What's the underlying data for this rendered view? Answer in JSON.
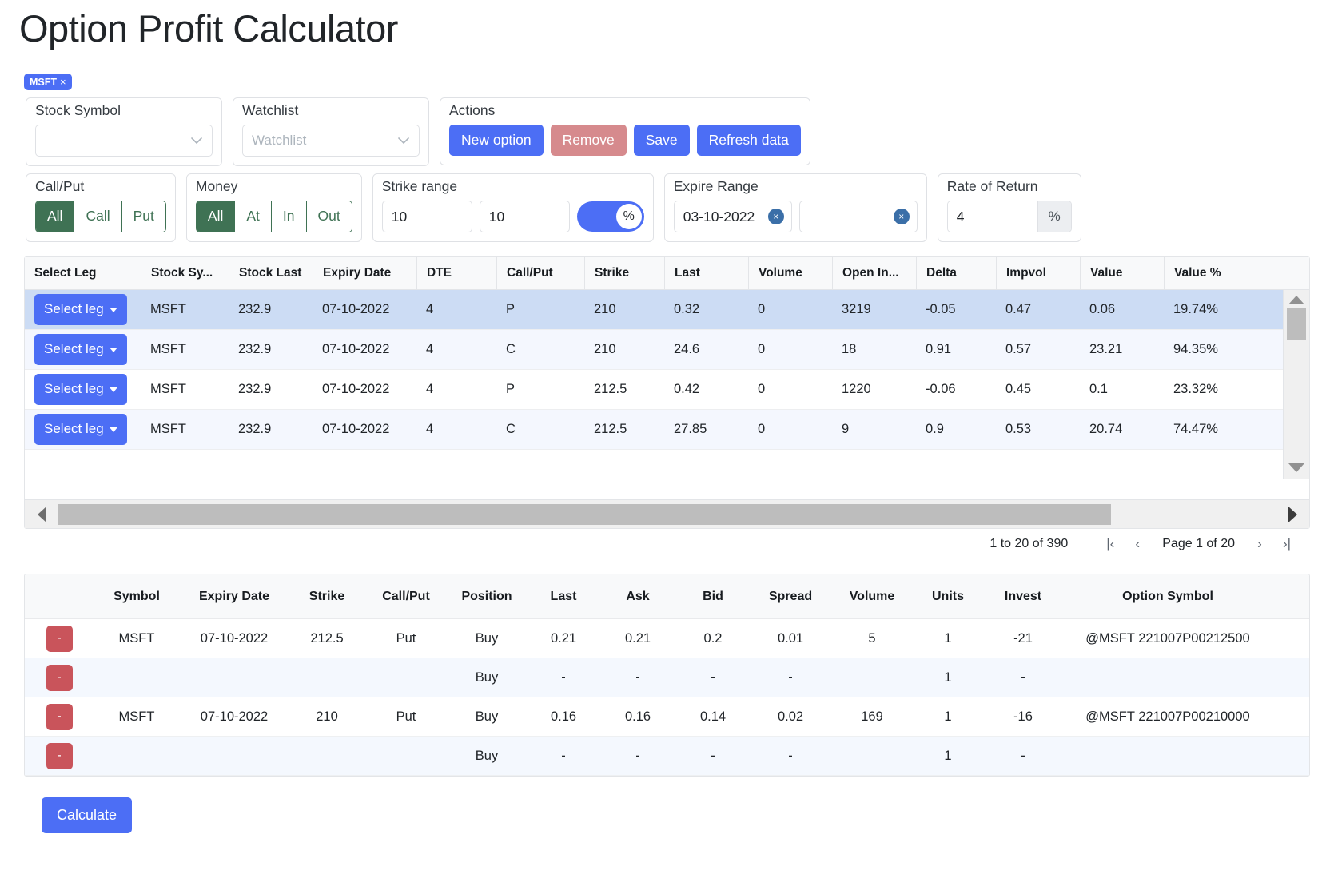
{
  "page_title": "Option Profit Calculator",
  "symbol_chip": {
    "label": "MSFT",
    "close": "×"
  },
  "filters": {
    "stock_symbol": {
      "legend": "Stock Symbol",
      "value": "",
      "placeholder": ""
    },
    "watchlist": {
      "legend": "Watchlist",
      "value": "",
      "placeholder": "Watchlist"
    },
    "actions": {
      "legend": "Actions",
      "new_option": "New option",
      "remove": "Remove",
      "save": "Save",
      "refresh": "Refresh data"
    },
    "call_put": {
      "legend": "Call/Put",
      "options": [
        "All",
        "Call",
        "Put"
      ],
      "selected": "All"
    },
    "money": {
      "legend": "Money",
      "options": [
        "All",
        "At",
        "In",
        "Out"
      ],
      "selected": "All"
    },
    "strike_range": {
      "legend": "Strike range",
      "low": "10",
      "high": "10",
      "percent_toggle": "%",
      "percent_on": true
    },
    "expire_range": {
      "legend": "Expire Range",
      "from": "03-10-2022",
      "to": "",
      "clear": "×"
    },
    "rate_of_return": {
      "legend": "Rate of Return",
      "value": "4",
      "suffix": "%"
    }
  },
  "options_grid": {
    "columns": [
      "Select Leg",
      "Stock Sy...",
      "Stock Last",
      "Expiry Date",
      "DTE",
      "Call/Put",
      "Strike",
      "Last",
      "Volume",
      "Open In...",
      "Delta",
      "Impvol",
      "Value",
      "Value %"
    ],
    "select_leg_label": "Select leg",
    "rows": [
      {
        "symbol": "MSFT",
        "stock_last": "232.9",
        "expiry": "07-10-2022",
        "dte": "4",
        "cp": "P",
        "strike": "210",
        "last": "0.32",
        "volume": "0",
        "open_int": "3219",
        "delta": "-0.05",
        "impvol": "0.47",
        "value": "0.06",
        "value_pct": "19.74%"
      },
      {
        "symbol": "MSFT",
        "stock_last": "232.9",
        "expiry": "07-10-2022",
        "dte": "4",
        "cp": "C",
        "strike": "210",
        "last": "24.6",
        "volume": "0",
        "open_int": "18",
        "delta": "0.91",
        "impvol": "0.57",
        "value": "23.21",
        "value_pct": "94.35%"
      },
      {
        "symbol": "MSFT",
        "stock_last": "232.9",
        "expiry": "07-10-2022",
        "dte": "4",
        "cp": "P",
        "strike": "212.5",
        "last": "0.42",
        "volume": "0",
        "open_int": "1220",
        "delta": "-0.06",
        "impvol": "0.45",
        "value": "0.1",
        "value_pct": "23.32%"
      },
      {
        "symbol": "MSFT",
        "stock_last": "232.9",
        "expiry": "07-10-2022",
        "dte": "4",
        "cp": "C",
        "strike": "212.5",
        "last": "27.85",
        "volume": "0",
        "open_int": "9",
        "delta": "0.9",
        "impvol": "0.53",
        "value": "20.74",
        "value_pct": "74.47%"
      }
    ],
    "pagination": {
      "range_text_prefix": "1",
      "range_text": "1 to 20 of 390",
      "first": "|‹",
      "prev": "‹",
      "page_label": "Page 1 of 20",
      "next": "›",
      "last": "›|"
    }
  },
  "legs_table": {
    "columns": [
      "",
      "Symbol",
      "Expiry Date",
      "Strike",
      "Call/Put",
      "Position",
      "Last",
      "Ask",
      "Bid",
      "Spread",
      "Volume",
      "Units",
      "Invest",
      "Option Symbol"
    ],
    "remove_label": "-",
    "rows": [
      {
        "symbol": "MSFT",
        "expiry": "07-10-2022",
        "strike": "212.5",
        "cp": "Put",
        "position": "Buy",
        "last": "0.21",
        "ask": "0.21",
        "bid": "0.2",
        "spread": "0.01",
        "volume": "5",
        "units": "1",
        "invest": "-21",
        "option_symbol": "@MSFT 221007P00212500"
      },
      {
        "symbol": "",
        "expiry": "",
        "strike": "",
        "cp": "",
        "position": "Buy",
        "last": "-",
        "ask": "-",
        "bid": "-",
        "spread": "-",
        "volume": "",
        "units": "1",
        "invest": "-",
        "option_symbol": ""
      },
      {
        "symbol": "MSFT",
        "expiry": "07-10-2022",
        "strike": "210",
        "cp": "Put",
        "position": "Buy",
        "last": "0.16",
        "ask": "0.16",
        "bid": "0.14",
        "spread": "0.02",
        "volume": "169",
        "units": "1",
        "invest": "-16",
        "option_symbol": "@MSFT 221007P00210000"
      },
      {
        "symbol": "",
        "expiry": "",
        "strike": "",
        "cp": "",
        "position": "Buy",
        "last": "-",
        "ask": "-",
        "bid": "-",
        "spread": "-",
        "volume": "",
        "units": "1",
        "invest": "-",
        "option_symbol": ""
      }
    ]
  },
  "calculate_button": "Calculate",
  "colors": {
    "primary_blue": "#4c6ef5",
    "danger_red": "#d68a8d",
    "remove_red": "#c9545b",
    "segment_green": "#3f7254",
    "selected_row": "#ccdcf4"
  }
}
